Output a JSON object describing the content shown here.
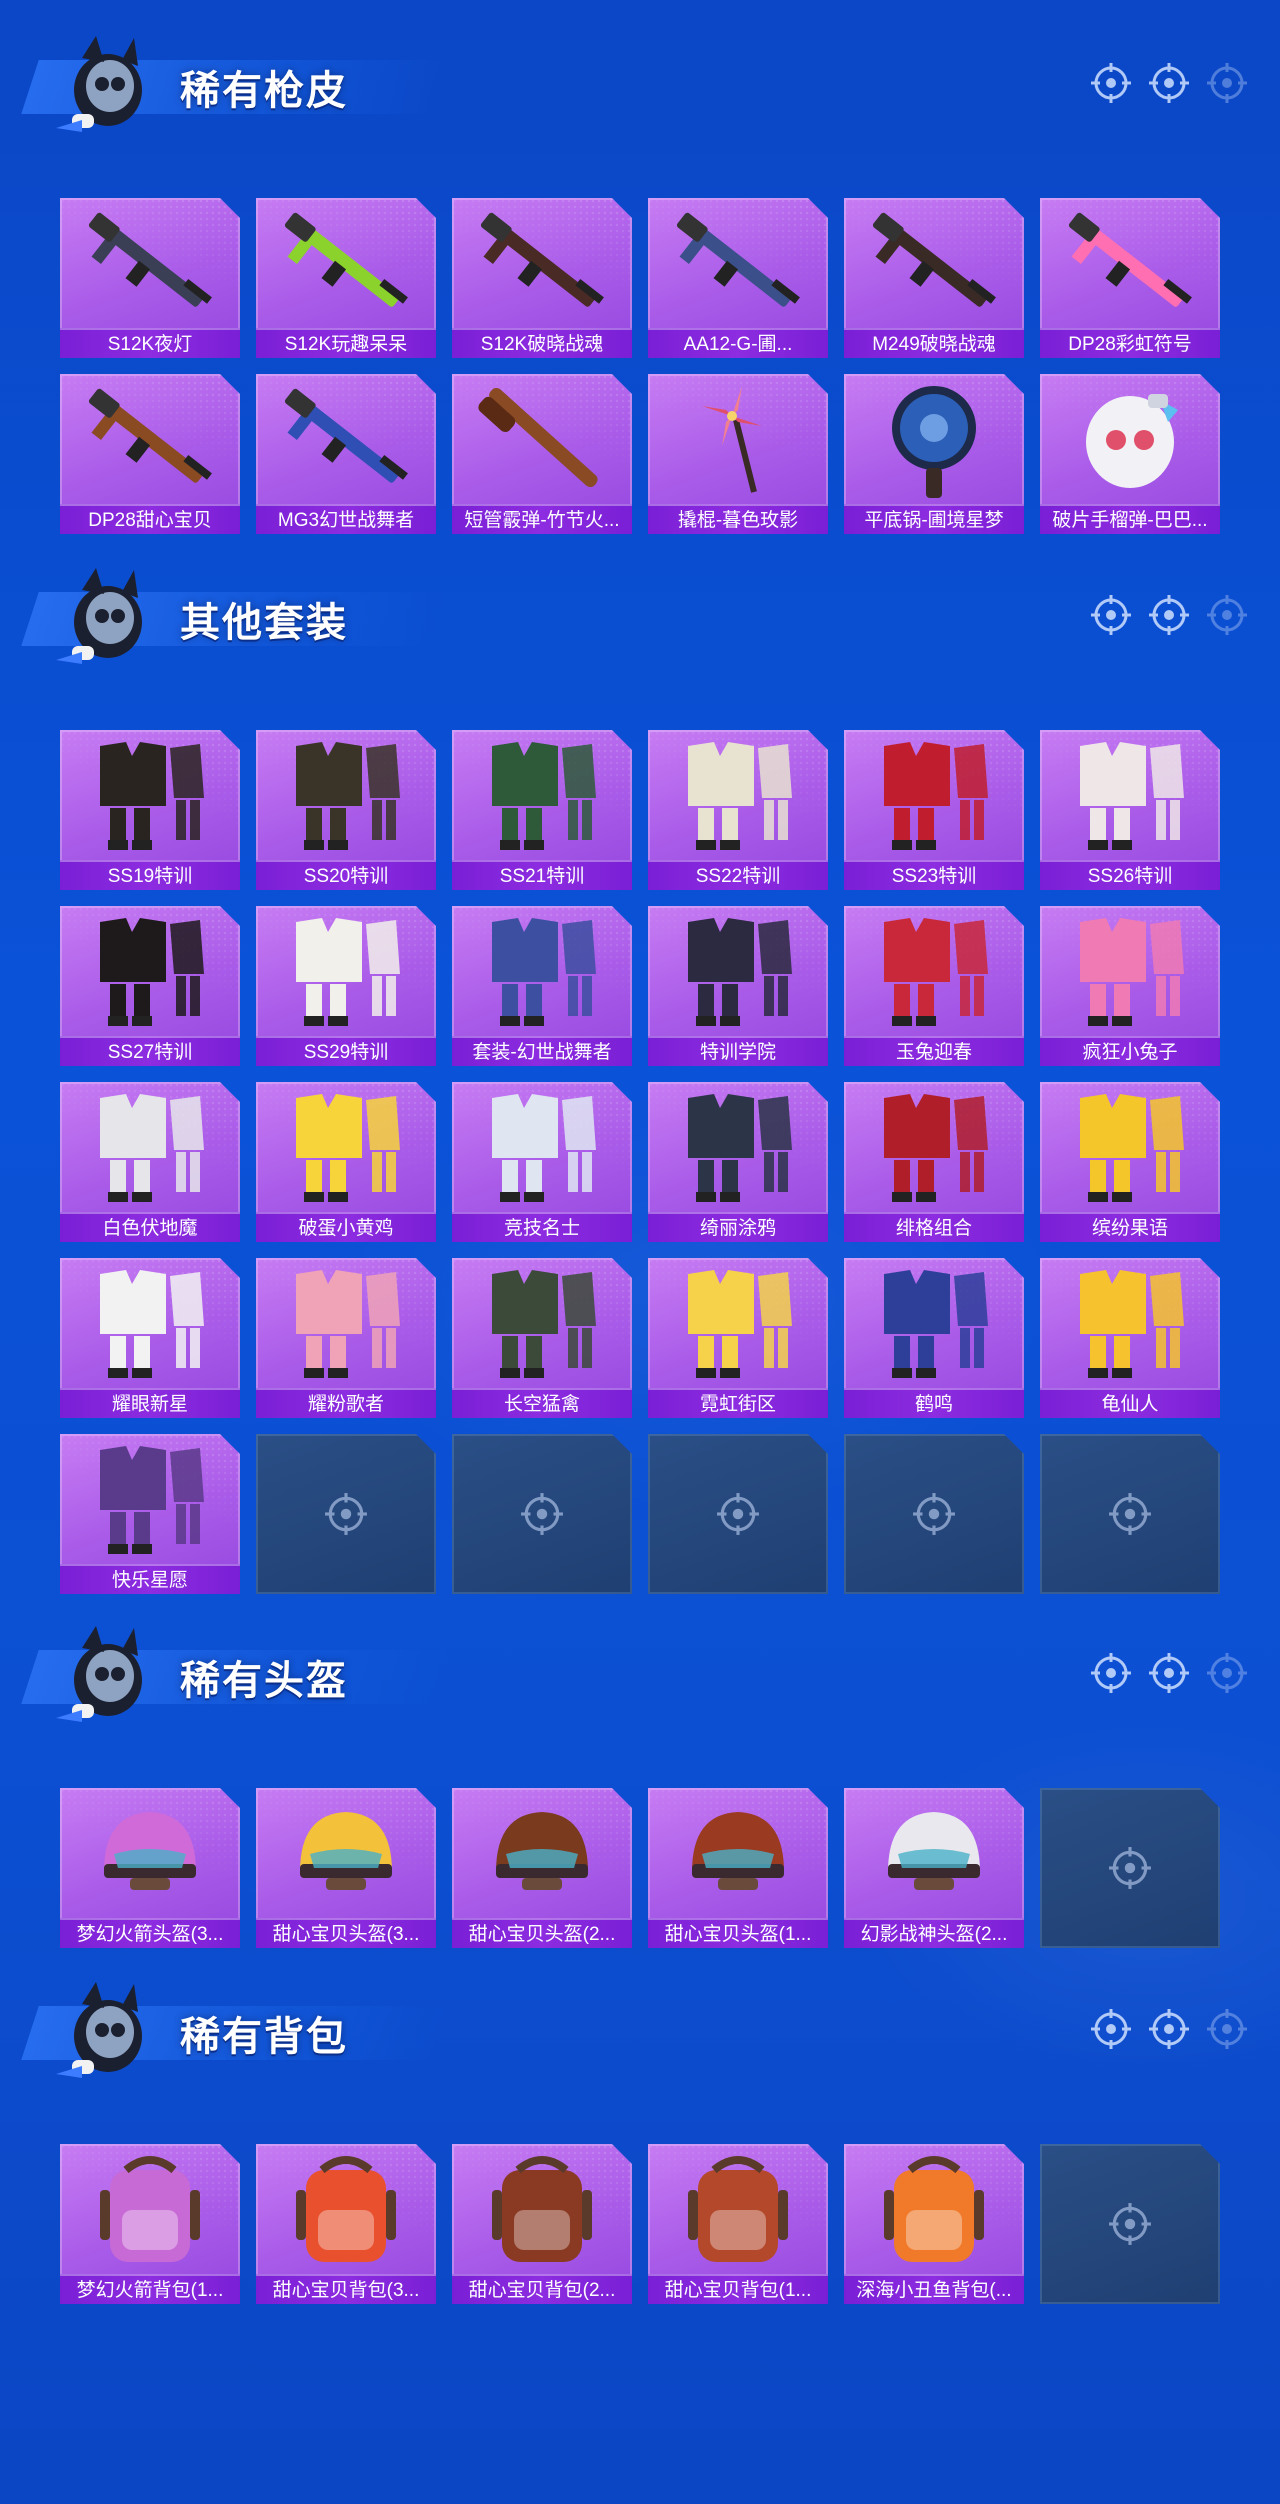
{
  "sections": {
    "guns": {
      "title": "稀有枪皮",
      "items": [
        {
          "label": "S12K夜灯",
          "art": "rifle-icon",
          "color": "#3a3f55"
        },
        {
          "label": "S12K玩趣呆呆",
          "art": "rifle-icon",
          "color": "#8bd32c"
        },
        {
          "label": "S12K破晓战魂",
          "art": "rifle-icon",
          "color": "#4a2a24"
        },
        {
          "label": "AA12-G-圃...",
          "art": "rifle-icon",
          "color": "#3b4f8a"
        },
        {
          "label": "M249破晓战魂",
          "art": "rifle-icon",
          "color": "#3a2a26"
        },
        {
          "label": "DP28彩虹符号",
          "art": "rifle-icon",
          "color": "#ff6fb1"
        },
        {
          "label": "DP28甜心宝贝",
          "art": "rifle-icon",
          "color": "#8a4a22"
        },
        {
          "label": "MG3幻世战舞者",
          "art": "rifle-icon",
          "color": "#2f4fb4"
        },
        {
          "label": "短管霰弹-竹节火...",
          "art": "shotgun-icon",
          "color": "#8a4a24"
        },
        {
          "label": "撬棍-暮色玫影",
          "art": "pinwheel-icon",
          "color": "#e0506a"
        },
        {
          "label": "平底锅-圃境星梦",
          "art": "pan-icon",
          "color": "#2b5fb8"
        },
        {
          "label": "破片手榴弹-巴巴...",
          "art": "grenade-icon",
          "color": "#f2f2f6"
        }
      ]
    },
    "outfits": {
      "title": "其他套装",
      "items": [
        {
          "label": "SS19特训",
          "art": "outfit-icon",
          "color": "#2a2420"
        },
        {
          "label": "SS20特训",
          "art": "outfit-icon",
          "color": "#3a3428"
        },
        {
          "label": "SS21特训",
          "art": "outfit-icon",
          "color": "#2e5a3a"
        },
        {
          "label": "SS22特训",
          "art": "outfit-icon",
          "color": "#e8e2d0"
        },
        {
          "label": "SS23特训",
          "art": "outfit-icon",
          "color": "#c01e2e"
        },
        {
          "label": "SS26特训",
          "art": "outfit-icon",
          "color": "#efe6e8"
        },
        {
          "label": "SS27特训",
          "art": "outfit-icon",
          "color": "#1e1a1c"
        },
        {
          "label": "SS29特训",
          "art": "outfit-icon",
          "color": "#f2f0ea"
        },
        {
          "label": "套装-幻世战舞者",
          "art": "outfit-icon",
          "color": "#3d4fa0"
        },
        {
          "label": "特训学院",
          "art": "outfit-icon",
          "color": "#2b2a40"
        },
        {
          "label": "玉兔迎春",
          "art": "outfit-icon",
          "color": "#c8283a"
        },
        {
          "label": "疯狂小兔子",
          "art": "outfit-icon",
          "color": "#f07ab4"
        },
        {
          "label": "白色伏地魔",
          "art": "outfit-icon",
          "color": "#e6e6ea"
        },
        {
          "label": "破蛋小黄鸡",
          "art": "outfit-icon",
          "color": "#f7d43a"
        },
        {
          "label": "竞技名士",
          "art": "outfit-icon",
          "color": "#dfe6f2"
        },
        {
          "label": "绮丽涂鸦",
          "art": "outfit-icon",
          "color": "#2c3448"
        },
        {
          "label": "绯格组合",
          "art": "outfit-icon",
          "color": "#b01e2a"
        },
        {
          "label": "缤纷果语",
          "art": "outfit-icon",
          "color": "#f5c62a"
        },
        {
          "label": "耀眼新星",
          "art": "outfit-icon",
          "color": "#f2f2f2"
        },
        {
          "label": "耀粉歌者",
          "art": "outfit-icon",
          "color": "#f0a2b6"
        },
        {
          "label": "长空猛禽",
          "art": "outfit-icon",
          "color": "#3c4a3a"
        },
        {
          "label": "霓虹街区",
          "art": "outfit-icon",
          "color": "#f5d24a"
        },
        {
          "label": "鹤鸣",
          "art": "outfit-icon",
          "color": "#2e3f9a"
        },
        {
          "label": "龟仙人",
          "art": "outfit-icon",
          "color": "#f6c32e"
        },
        {
          "label": "快乐星愿",
          "art": "outfit-icon",
          "color": "#5a3a8a"
        }
      ],
      "empty_slots": 5
    },
    "helmets": {
      "title": "稀有头盔",
      "items": [
        {
          "label": "梦幻火箭头盔(3...",
          "art": "helmet-icon",
          "color": "#d06ad8"
        },
        {
          "label": "甜心宝贝头盔(3...",
          "art": "helmet-icon",
          "color": "#f3c23a"
        },
        {
          "label": "甜心宝贝头盔(2...",
          "art": "helmet-icon",
          "color": "#7a3a1e"
        },
        {
          "label": "甜心宝贝头盔(1...",
          "art": "helmet-icon",
          "color": "#9a3a20"
        },
        {
          "label": "幻影战神头盔(2...",
          "art": "helmet-icon",
          "color": "#e8e8ee"
        }
      ],
      "empty_slots": 1
    },
    "backpacks": {
      "title": "稀有背包",
      "items": [
        {
          "label": "梦幻火箭背包(1...",
          "art": "backpack-icon",
          "color": "#c86ad6"
        },
        {
          "label": "甜心宝贝背包(3...",
          "art": "backpack-icon",
          "color": "#e8502e"
        },
        {
          "label": "甜心宝贝背包(2...",
          "art": "backpack-icon",
          "color": "#8a3a22"
        },
        {
          "label": "甜心宝贝背包(1...",
          "art": "backpack-icon",
          "color": "#b4482a"
        },
        {
          "label": "深海小丑鱼背包(...",
          "art": "backpack-icon",
          "color": "#f07a2a"
        }
      ],
      "empty_slots": 1
    }
  }
}
